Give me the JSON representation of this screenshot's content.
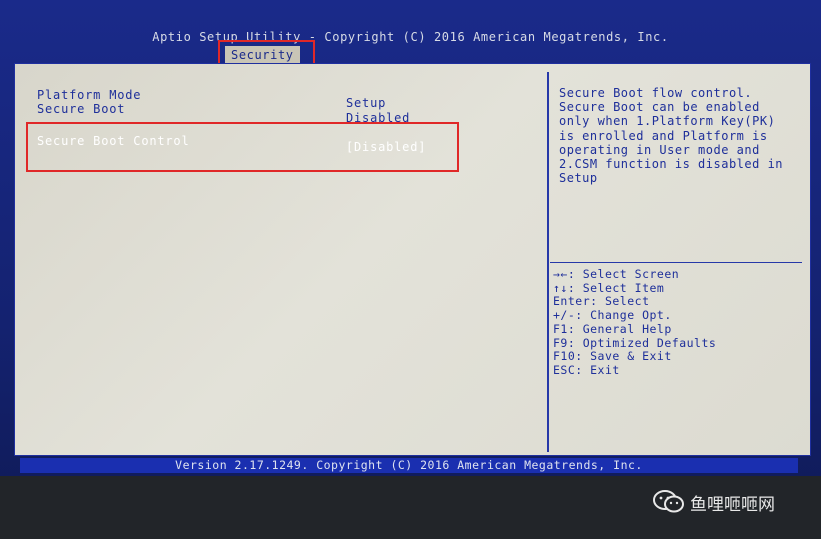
{
  "header": {
    "title": "Aptio Setup Utility - Copyright (C) 2016 American Megatrends, Inc.",
    "active_tab": "Security"
  },
  "settings": [
    {
      "label": "Platform Mode",
      "value": ""
    },
    {
      "label": "Secure Boot",
      "value": "Setup"
    },
    {
      "label": "",
      "value": "Disabled"
    },
    {
      "label": "Secure Boot Control",
      "value": "[Disabled]"
    }
  ],
  "help": {
    "lines": [
      "Secure Boot flow control.",
      "Secure Boot can be enabled",
      "only when 1.Platform Key(PK)",
      "is enrolled and Platform is",
      "operating in User mode and",
      "2.CSM function is disabled in",
      "Setup"
    ]
  },
  "keys": [
    "→←: Select Screen",
    "↑↓: Select Item",
    "Enter: Select",
    "+/-: Change Opt.",
    "F1: General Help",
    "F9: Optimized Defaults",
    "F10: Save & Exit",
    "ESC: Exit"
  ],
  "footer": {
    "text": "Version 2.17.1249. Copyright (C) 2016 American Megatrends, Inc."
  },
  "watermark": {
    "text": "鱼哩咂咂网",
    "icon": "wechat-icon"
  },
  "colors": {
    "bios_blue": "#1e2f9a",
    "panel_bg": "#dcdbd1",
    "highlight_red": "#e02828"
  }
}
